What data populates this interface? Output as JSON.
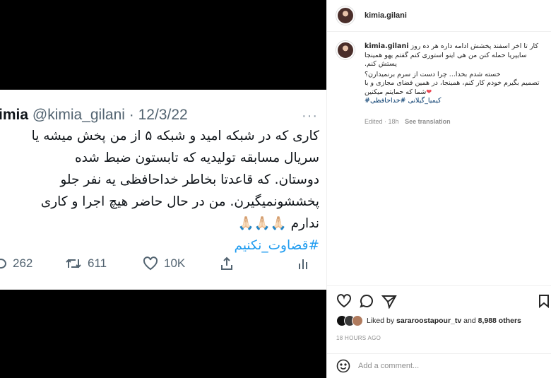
{
  "tweet": {
    "name": "imia",
    "handle": "@kimia_gilani",
    "separator": "·",
    "date": "12/3/22",
    "more": "···",
    "lines": [
      "کاری که در شبکه امید و شبکه ۵ از من پخش میشه یا",
      "سریال مسابقه تولیدیه که تابستون ضبط شده",
      "دوستان. که قاعدتا بخاطر خداحافظی یه نفر جلو",
      "پخششونمیگیرن. من در حال حاضر هیچ اجرا و کاری",
      "ندارم 🙏🏻🙏🏻🙏🏻"
    ],
    "hashtag": "#قضاوت_نکنیم",
    "reply_count": "262",
    "retweet_count": "611",
    "like_count": "10K"
  },
  "header": {
    "username": "kimia.gilani"
  },
  "caption": {
    "username": "kimia.gilani",
    "line1": "کار تا اخر اسفند پخشش ادامه داره هر ده روز",
    "line2": "سایپریا حمله کنن من هی اینو استوری کنم گفتم یهو همینجا",
    "line3": "پستش کنم.",
    "line4": "خسته شدم بخدا... چرا دست از سرم برنمیدارن؟",
    "line5": "تصمیم بگیرم خودم کار کنم، همینجا، در همین فضای مجازی و با",
    "line6": "شما که حمایتم میکنین",
    "heart": "❤",
    "tags": "کیمیا_گیلانی #خداحافظی#",
    "edited": "Edited · 18h",
    "see_translation": "See translation"
  },
  "likes": {
    "prefix": "Liked by",
    "user": "sararoostapour_tv",
    "middle": "and",
    "others": "8,988 others"
  },
  "time_ago": "18 HOURS AGO",
  "comment": {
    "placeholder": "Add a comment..."
  }
}
